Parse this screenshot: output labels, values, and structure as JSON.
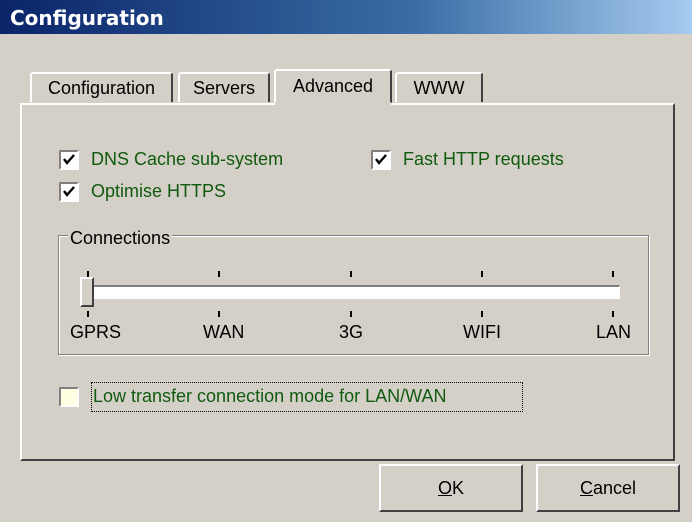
{
  "window": {
    "title": "Configuration"
  },
  "tabs": [
    {
      "label": "Configuration",
      "active": false
    },
    {
      "label": "Servers",
      "active": false
    },
    {
      "label": "Advanced",
      "active": true
    },
    {
      "label": "WWW",
      "active": false
    }
  ],
  "options": {
    "dns_cache": {
      "label": "DNS Cache sub-system",
      "checked": true
    },
    "fast_http": {
      "label": "Fast HTTP requests",
      "checked": true
    },
    "optimise_https": {
      "label": "Optimise HTTPS",
      "checked": true
    },
    "low_transfer": {
      "label": "Low transfer connection mode for LAN/WAN",
      "checked": false
    }
  },
  "connections": {
    "label": "Connections",
    "levels": [
      "GPRS",
      "WAN",
      "3G",
      "WIFI",
      "LAN"
    ],
    "selected": "GPRS"
  },
  "buttons": {
    "ok": {
      "mnemonic": "O",
      "rest": "K"
    },
    "cancel": {
      "mnemonic": "C",
      "rest": "ancel"
    }
  },
  "colors": {
    "label_text": "#0f5a0f",
    "titlebar_start": "#0a246a"
  }
}
